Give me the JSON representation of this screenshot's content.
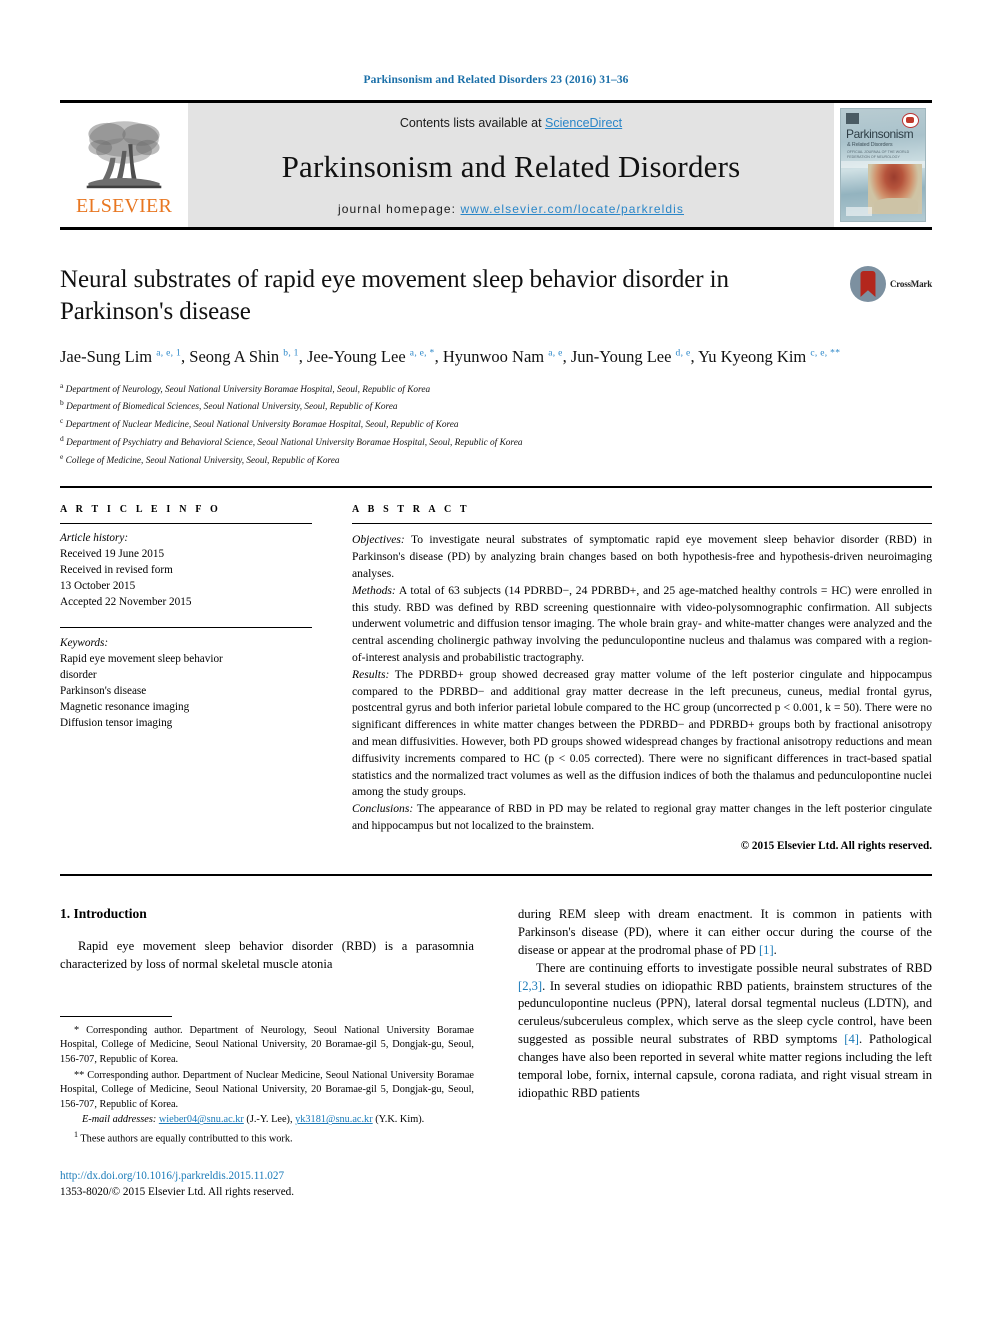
{
  "running_head": "Parkinsonism and Related Disorders 23 (2016) 31–36",
  "masthead": {
    "contents_prefix": "Contents lists available at ",
    "sciencedirect": "ScienceDirect",
    "journal_title": "Parkinsonism and Related Disorders",
    "homepage_prefix": "journal homepage: ",
    "homepage_url": "www.elsevier.com/locate/parkreldis",
    "publisher": "ELSEVIER",
    "cover": {
      "title": "Parkinsonism",
      "subtitle": "& Related Disorders",
      "meta": "OFFICIAL JOURNAL OF THE WORLD FEDERATION OF NEUROLOGY"
    },
    "link_color": "#2a86c8",
    "band_color": "#e3e3e3",
    "elsevier_orange": "#E87722"
  },
  "article": {
    "title": "Neural substrates of rapid eye movement sleep behavior disorder in Parkinson's disease",
    "crossmark_label": "CrossMark",
    "authors_line1": "Jae-Sung Lim",
    "authors": [
      {
        "name": "Jae-Sung Lim",
        "marks": "a, e, 1",
        "sep": ", "
      },
      {
        "name": "Seong A Shin",
        "marks": "b, 1",
        "sep": ", "
      },
      {
        "name": "Jee-Young Lee",
        "marks": "a, e, *",
        "sep": ", "
      },
      {
        "name": "Hyunwoo Nam",
        "marks": "a, e",
        "sep": ", "
      },
      {
        "name": "Jun-Young Lee",
        "marks": "d, e",
        "sep": ", "
      },
      {
        "name": "Yu Kyeong Kim",
        "marks": "c, e, **",
        "sep": ""
      }
    ],
    "affiliations": [
      {
        "mark": "a",
        "text": "Department of Neurology, Seoul National University Boramae Hospital, Seoul, Republic of Korea"
      },
      {
        "mark": "b",
        "text": "Department of Biomedical Sciences, Seoul National University, Seoul, Republic of Korea"
      },
      {
        "mark": "c",
        "text": "Department of Nuclear Medicine, Seoul National University Boramae Hospital, Seoul, Republic of Korea"
      },
      {
        "mark": "d",
        "text": "Department of Psychiatry and Behavioral Science, Seoul National University Boramae Hospital, Seoul, Republic of Korea"
      },
      {
        "mark": "e",
        "text": "College of Medicine, Seoul National University, Seoul, Republic of Korea"
      }
    ]
  },
  "article_info": {
    "heading": "A R T I C L E   I N F O",
    "history_label": "Article history:",
    "history": [
      "Received 19 June 2015",
      "Received in revised form",
      "13 October 2015",
      "Accepted 22 November 2015"
    ],
    "keywords_label": "Keywords:",
    "keywords": [
      "Rapid eye movement sleep behavior",
      "disorder",
      "Parkinson's disease",
      "Magnetic resonance imaging",
      "Diffusion tensor imaging"
    ]
  },
  "abstract": {
    "heading": "A B S T R A C T",
    "objectives_label": "Objectives:",
    "objectives_text": " To investigate neural substrates of symptomatic rapid eye movement sleep behavior disorder (RBD) in Parkinson's disease (PD) by analyzing brain changes based on both hypothesis-free and hypothesis-driven neuroimaging analyses.",
    "methods_label": "Methods:",
    "methods_text": " A total of 63 subjects (14 PDRBD−, 24 PDRBD+, and 25 age-matched healthy controls = HC) were enrolled in this study. RBD was defined by RBD screening questionnaire with video-polysomnographic confirmation. All subjects underwent volumetric and diffusion tensor imaging. The whole brain gray- and white-matter changes were analyzed and the central ascending cholinergic pathway involving the pedunculopontine nucleus and thalamus was compared with a region-of-interest analysis and probabilistic tractography.",
    "results_label": "Results:",
    "results_text": " The PDRBD+ group showed decreased gray matter volume of the left posterior cingulate and hippocampus compared to the PDRBD− and additional gray matter decrease in the left precuneus, cuneus, medial frontal gyrus, postcentral gyrus and both inferior parietal lobule compared to the HC group (uncorrected p < 0.001, k = 50). There were no significant differences in white matter changes between the PDRBD− and PDRBD+ groups both by fractional anisotropy and mean diffusivities. However, both PD groups showed widespread changes by fractional anisotropy reductions and mean diffusivity increments compared to HC (p < 0.05 corrected). There were no significant differences in tract-based spatial statistics and the normalized tract volumes as well as the diffusion indices of both the thalamus and pedunculopontine nuclei among the study groups.",
    "conclusions_label": "Conclusions:",
    "conclusions_text": " The appearance of RBD in PD may be related to regional gray matter changes in the left posterior cingulate and hippocampus but not localized to the brainstem.",
    "copyright": "© 2015 Elsevier Ltd. All rights reserved."
  },
  "introduction": {
    "section_number_title": "1. Introduction",
    "left_para": "Rapid eye movement sleep behavior disorder (RBD) is a parasomnia characterized by loss of normal skeletal muscle atonia",
    "right_para1_a": "during REM sleep with dream enactment. It is common in patients with Parkinson's disease (PD), where it can either occur during the course of the disease or appear at the prodromal phase of PD ",
    "right_para1_ref": "[1]",
    "right_para1_b": ".",
    "right_para2_a": "There are continuing efforts to investigate possible neural substrates of RBD ",
    "right_para2_ref1": "[2,3]",
    "right_para2_b": ". In several studies on idiopathic RBD patients, brainstem structures of the pedunculopontine nucleus (PPN), lateral dorsal tegmental nucleus (LDTN), and ceruleus/subceruleus complex, which serve as the sleep cycle control, have been suggested as possible neural substrates of RBD symptoms ",
    "right_para2_ref2": "[4]",
    "right_para2_c": ". Pathological changes have also been reported in several white matter regions including the left temporal lobe, fornix, internal capsule, corona radiata, and right visual stream in idiopathic RBD patients"
  },
  "footnotes": {
    "corresponding1_mark": "*",
    "corresponding1": " Corresponding author. Department of Neurology, Seoul National University Boramae Hospital, College of Medicine, Seoul National University, 20 Boramae-gil 5, Dongjak-gu, Seoul, 156-707, Republic of Korea.",
    "corresponding2_mark": "**",
    "corresponding2": " Corresponding author. Department of Nuclear Medicine, Seoul National University Boramae Hospital, College of Medicine, Seoul National University, 20 Boramae-gil 5, Dongjak-gu, Seoul, 156-707, Republic of Korea.",
    "email_label": "E-mail addresses:",
    "email1": "wieber04@snu.ac.kr",
    "email1_who": " (J.-Y. Lee), ",
    "email2": "yk3181@snu.ac.kr",
    "email2_who": " (Y.K. Kim).",
    "equal_mark": "1",
    "equal_text": " These authors are equally contributted to this work.",
    "doi": "http://dx.doi.org/10.1016/j.parkreldis.2015.11.027",
    "issn": "1353-8020/© 2015 Elsevier Ltd. All rights reserved."
  }
}
